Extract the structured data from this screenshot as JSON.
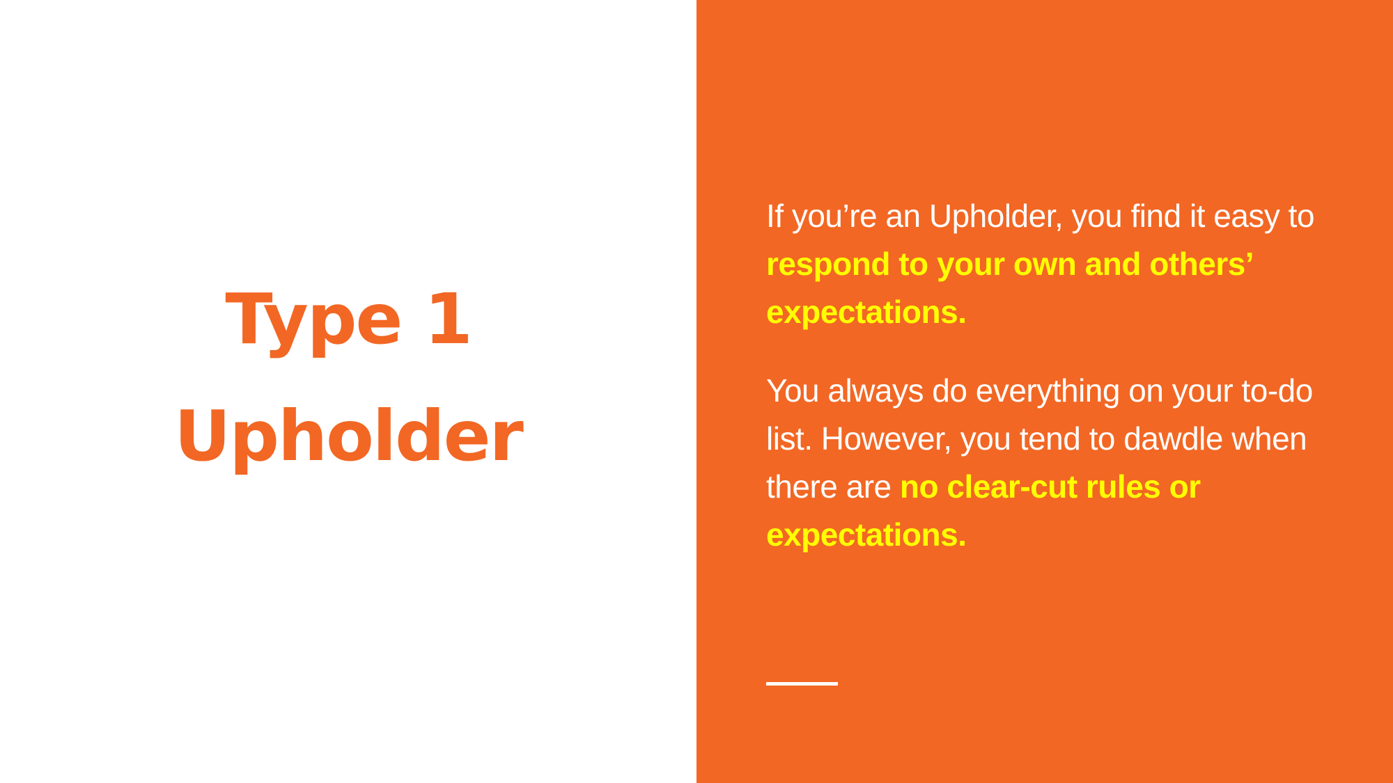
{
  "colors": {
    "accent": "#f26724",
    "highlight": "#ffff00",
    "text_on_accent": "#ffffff",
    "background": "#ffffff"
  },
  "title": {
    "line1": "Type 1",
    "line2": "Upholder"
  },
  "body": {
    "paragraph1": {
      "lead": "If you’re an Upholder, you find it easy to ",
      "highlight": "respond to your own and others’ expectations."
    },
    "paragraph2": {
      "lead": "You always do everything on your to-do list. However, you tend to dawdle when there are ",
      "highlight": "no clear-cut rules or expectations."
    }
  }
}
